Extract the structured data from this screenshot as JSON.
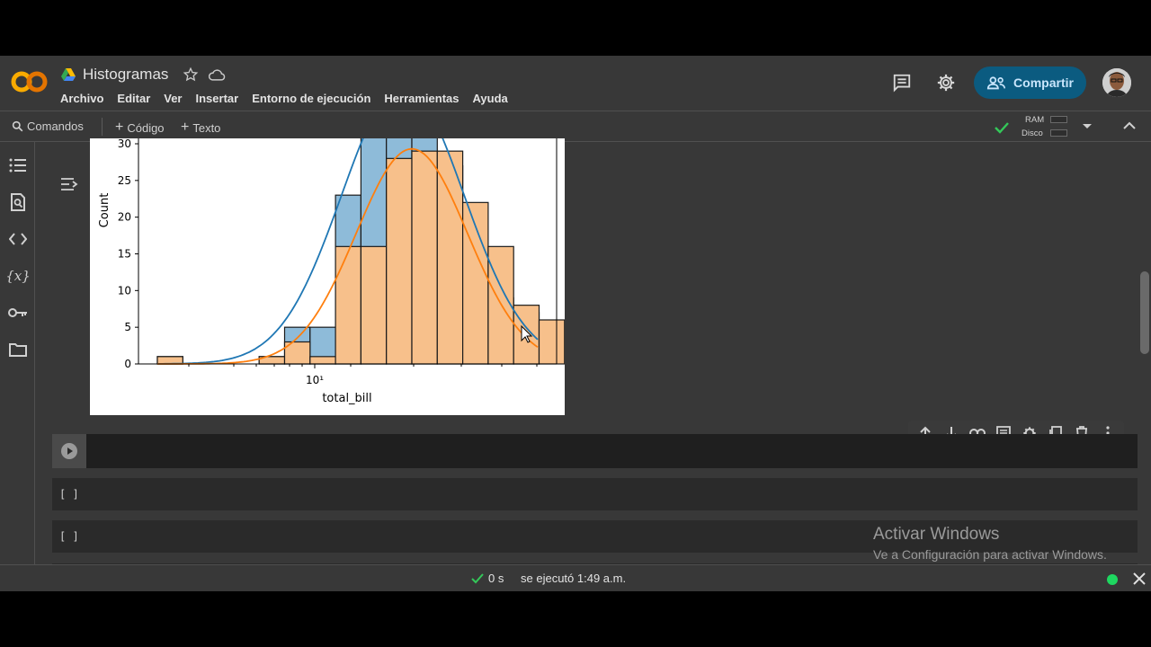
{
  "header": {
    "title": "Histogramas",
    "menu": [
      "Archivo",
      "Editar",
      "Ver",
      "Insertar",
      "Entorno de ejecución",
      "Herramientas",
      "Ayuda"
    ],
    "share_label": "Compartir"
  },
  "toolbar": {
    "commands_label": "Comandos",
    "add_code_label": "Código",
    "add_text_label": "Texto",
    "ram_label": "RAM",
    "disk_label": "Disco"
  },
  "cells": {
    "empty_bracket_1": "[ ]",
    "empty_bracket_2": "[ ]"
  },
  "status": {
    "elapsed": "0 s",
    "executed": "se ejecutó 1:49 a.m."
  },
  "watermark": {
    "line1": "Activar Windows",
    "line2": "Ve a Configuración para activar Windows."
  },
  "colors": {
    "blue_bar": "#8ebbd9",
    "orange_bar": "#f7c08b",
    "blue_line": "#1f77b4",
    "orange_line": "#ff7f0e",
    "accent_button": "#0b5b80"
  },
  "chart_data": {
    "type": "bar",
    "xlabel": "total_bill",
    "ylabel": "Count",
    "x_scale": "log",
    "x_tick_labels": [
      "10¹"
    ],
    "y_ticks": [
      "0",
      "5",
      "10",
      "15",
      "20",
      "25",
      "30"
    ],
    "ylim": [
      0,
      30
    ],
    "series": [
      {
        "values": [
          1,
          0,
          0,
          0,
          1,
          5,
          5,
          23,
          35,
          35,
          35,
          27,
          20,
          9,
          7
        ]
      },
      {
        "values": [
          1,
          0,
          0,
          0,
          1,
          3,
          1,
          16,
          16,
          28,
          29,
          29,
          22,
          16,
          8,
          6
        ]
      }
    ]
  }
}
